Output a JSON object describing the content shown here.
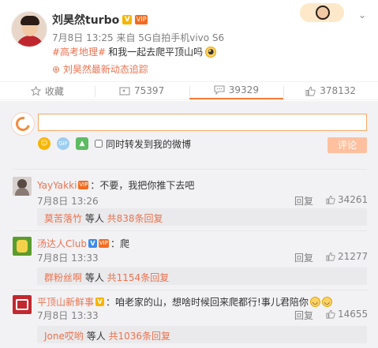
{
  "post": {
    "author": "刘昊然turbo",
    "v_badge": "V",
    "vip_badge": "VIP",
    "meta": "7月8日 13:25 来自 5G自拍手机vivo S6",
    "hashtag": "#高考地理#",
    "text": " 和我一起去爬平顶山吗",
    "track_link": "⊕ 刘昊然最新动态追踪"
  },
  "actions": {
    "favorite": "收藏",
    "repost": "75397",
    "comment": "39329",
    "like": "378132"
  },
  "composer": {
    "input_value": "",
    "repost_label": "同时转发到我的微博",
    "submit_label": "评论"
  },
  "comments": [
    {
      "name": "YayYakki",
      "text": "：不要，我把你推下去吧",
      "time": "7月8日 13:26",
      "reply": "回复",
      "likes": "34261",
      "sub_name": "莫苦落竹",
      "sub_mid": " 等人 ",
      "sub_count": "共838条回复"
    },
    {
      "name": "汤达人Club",
      "text": "：爬",
      "time": "7月8日 13:33",
      "reply": "回复",
      "likes": "21277",
      "sub_name": "群粉丝啊",
      "sub_mid": " 等人 ",
      "sub_count": "共1154条回复"
    },
    {
      "name": "平顶山新鲜事",
      "text": "：咱老家的山，想啥时候回来爬都行!事儿君陪你",
      "time": "7月8日 13:33",
      "reply": "回复",
      "likes": "14655",
      "sub_name": "Jone哎哟",
      "sub_mid": " 等人 ",
      "sub_count": "共1036条回复"
    }
  ],
  "colors": {
    "accent": "#eb7350",
    "panel_bg": "#f2f2f5",
    "submit_bg": "#ffc09f",
    "input_border": "#f5a865"
  }
}
